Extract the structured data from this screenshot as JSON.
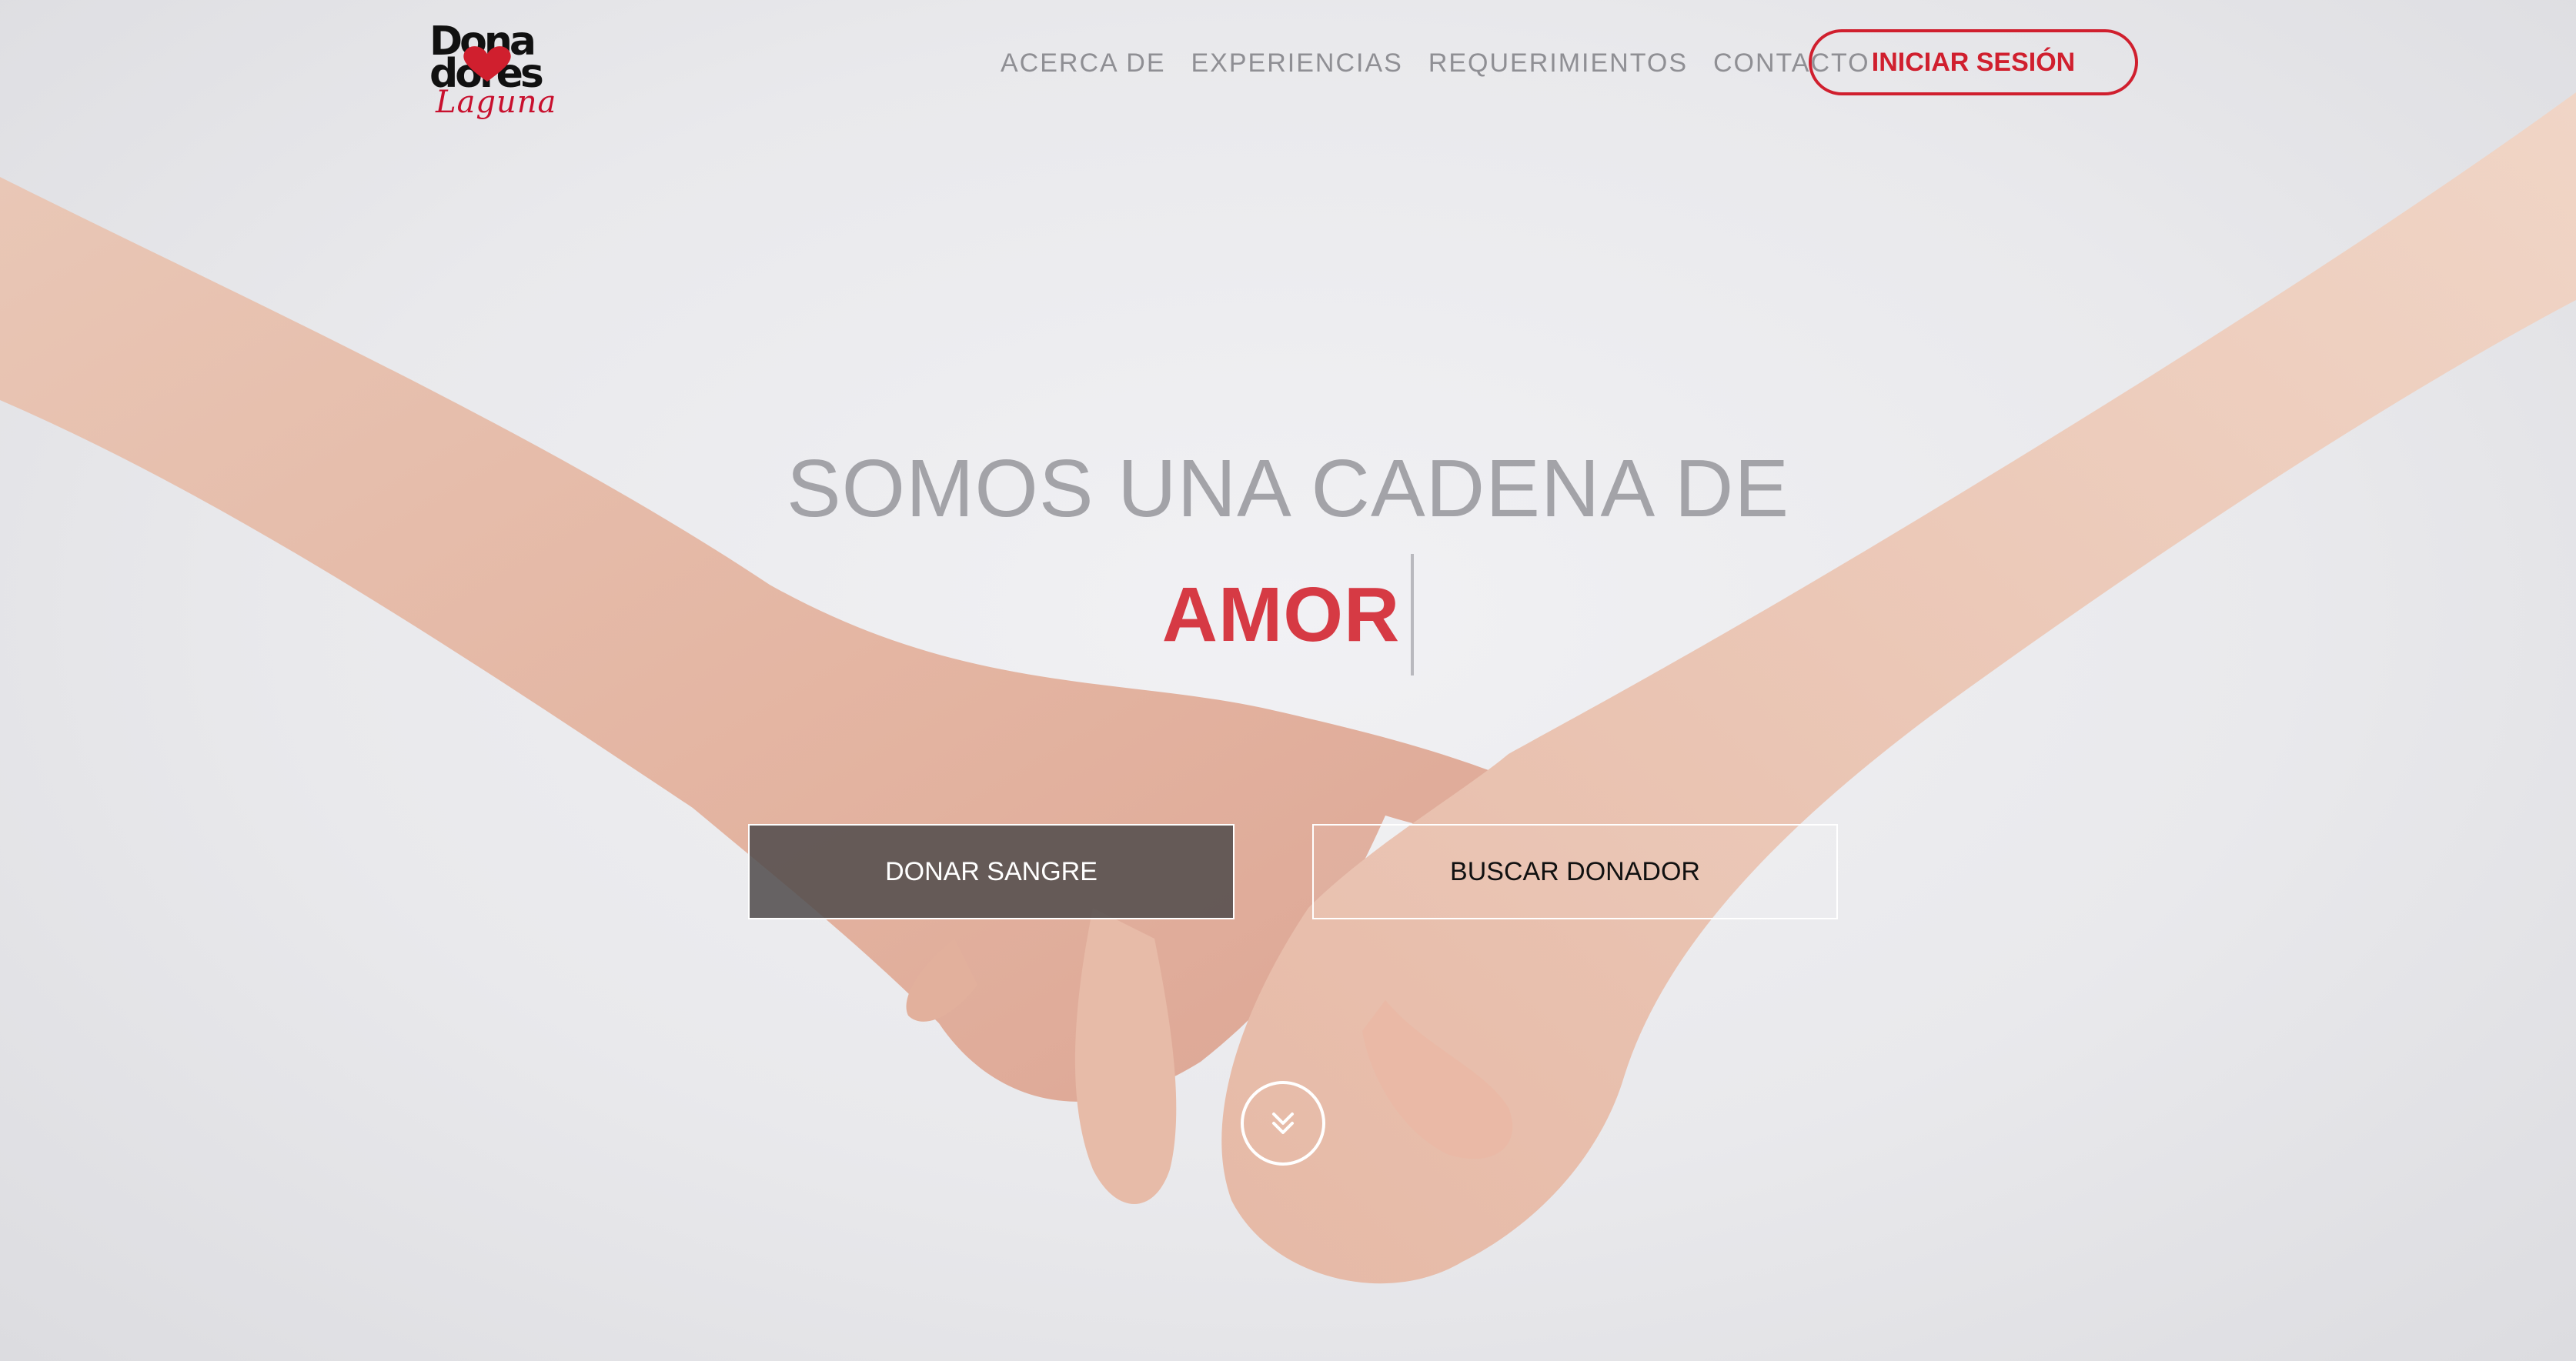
{
  "header": {
    "logo": {
      "line1": "Dona",
      "line2": "dores",
      "subtitle": "Laguna"
    },
    "nav": [
      {
        "label": "ACERCA DE"
      },
      {
        "label": "EXPERIENCIAS"
      },
      {
        "label": "REQUERIMIENTOS"
      },
      {
        "label": "CONTACTO"
      }
    ],
    "login_label": "INICIAR SESIÓN"
  },
  "hero": {
    "headline_line1": "SOMOS UNA CADENA DE",
    "headline_line2": "AMOR",
    "donate_button": "DONAR SANGRE",
    "search_button": "BUSCAR DONADOR",
    "scroll_icon": "double-chevron-down-icon"
  },
  "colors": {
    "accent_red": "#d01f2e",
    "headline_gray": "#a3a3a8",
    "headline_red": "#d63a44",
    "nav_gray": "#8f8f94"
  }
}
